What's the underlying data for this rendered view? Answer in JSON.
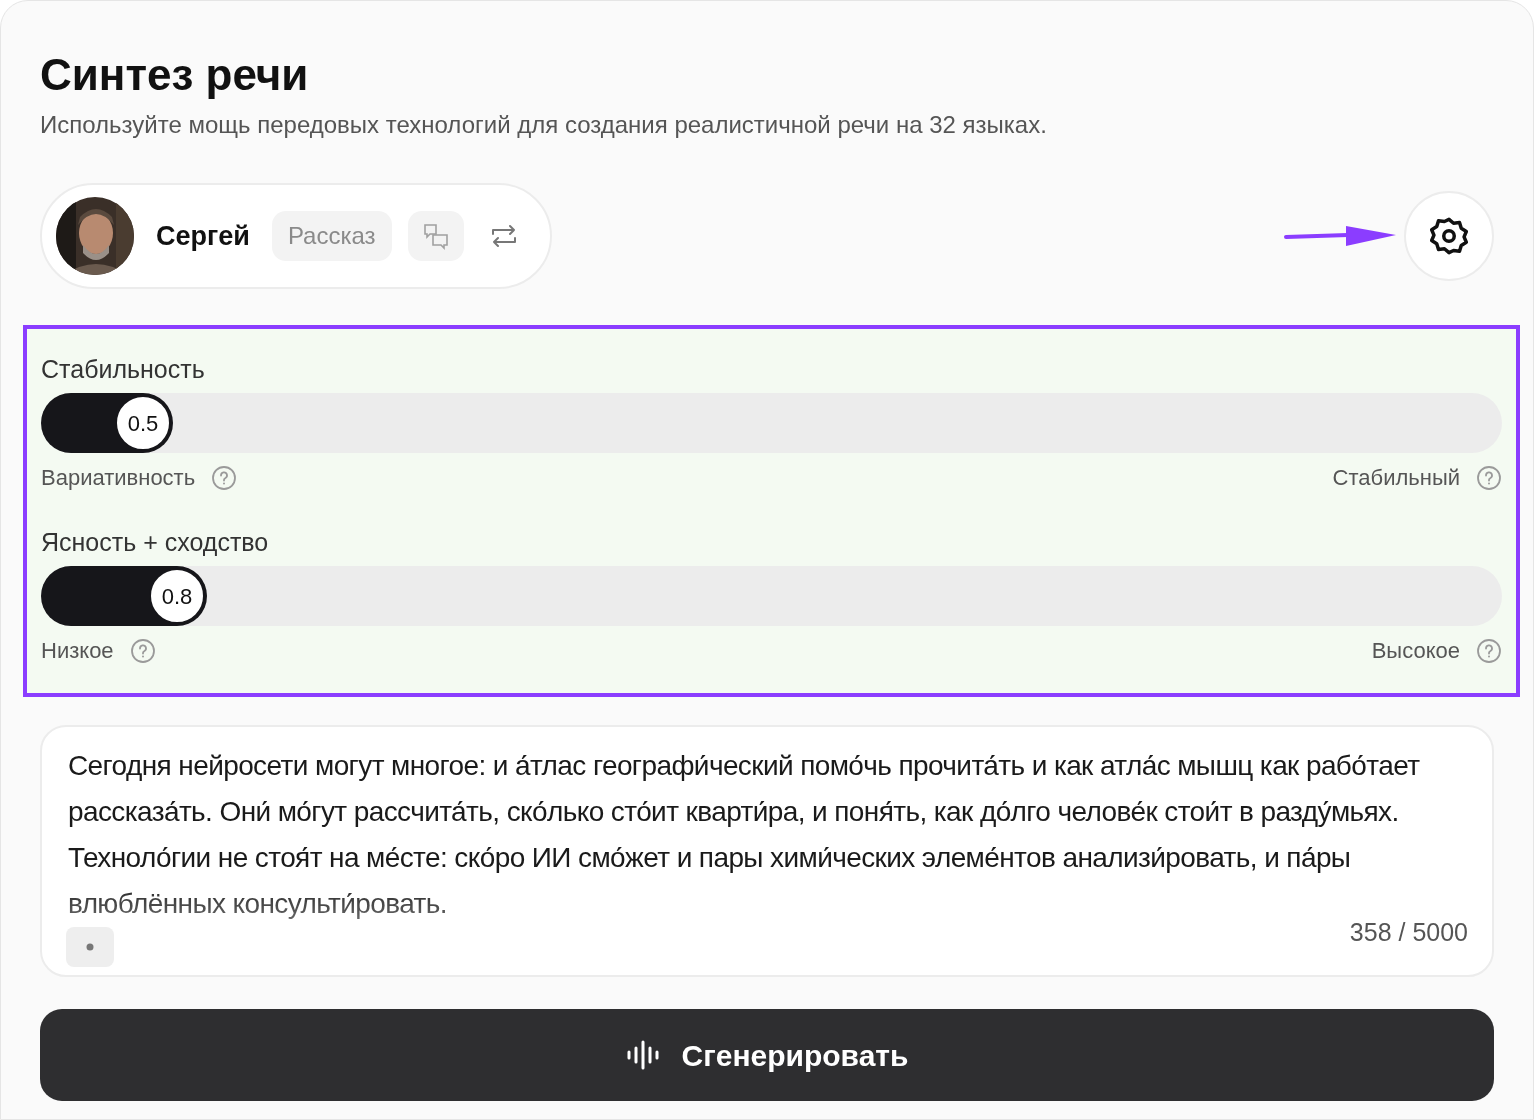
{
  "header": {
    "title": "Синтез речи",
    "subtitle": "Используйте мощь передовых технологий для создания реалистичной речи на 32 языках."
  },
  "voice": {
    "name": "Сергей",
    "style": "Рассказ"
  },
  "settings_panel": {
    "highlighted": true,
    "sliders": [
      {
        "title": "Стабильность",
        "reading": "0.5",
        "min_label": "Вариативность",
        "max_label": "Стабильный"
      },
      {
        "title": "Ясность + сходство",
        "reading": "0.8",
        "min_label": "Низкое",
        "max_label": "Высокое"
      }
    ]
  },
  "text_input": {
    "value": "Сегодня нейросети могут многое: и а́тлас географи́ческий помо́чь прочита́ть и как атла́с мышц как рабо́тает рассказа́ть. Они́ мо́гут рассчита́ть, ско́лько сто́ит кварти́ра, и поня́ть, как до́лго челове́к стои́т в разду́мьях. Техноло́гии не стоя́т на ме́сте: ско́ро ИИ смо́жет и пары хими́ческих элеме́нтов анализи́ровать, и па́ры влюблённых консульти́ровать.",
    "counter": "358 / 5000"
  },
  "generate_button": {
    "label": "Сгенерировать"
  }
}
